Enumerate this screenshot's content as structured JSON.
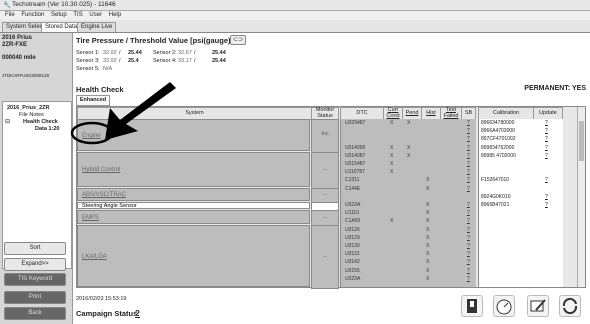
{
  "window": {
    "title": "Techstream (Ver 10.30.025) - 11646"
  },
  "menu": [
    "File",
    "Function",
    "Setup",
    "TIS",
    "User",
    "Help"
  ],
  "tabs": [
    "System Select",
    "Stored Data",
    "Engine Live"
  ],
  "vehicle": {
    "model": "2016 Prius",
    "engine": "2ZR-FXE",
    "mileage": "000040 mile",
    "vin": "JTDKARFU5G3008128"
  },
  "tree": {
    "root": "2016_Prius_2ZR",
    "file_notes": "File Notes",
    "health": "Health Check",
    "data": "Data 1:20"
  },
  "sidebar_buttons": [
    "Sort",
    "Expand>>",
    "TIS Keyword",
    "Print",
    "Back"
  ],
  "tire": {
    "title": "Tire Pressure / Threshold Value [psi(gauge)]",
    "sensor1_label": "Sensor 1:",
    "sensor1_value": "32.92",
    "sensor1_thr": "25.44",
    "sensor2_label": "Sensor 2:",
    "sensor2_value": "32.67",
    "sensor2_thr": "25.44",
    "sensor3_label": "Sensor 3:",
    "sensor3_value": "33.92",
    "sensor3_thr": "25.4",
    "sensor4_label": "Sensor 4:",
    "sensor4_value": "33.17",
    "sensor4_thr": "25.44",
    "sensor5_label": "Sensor 5:",
    "sensor5_value": "N/A"
  },
  "health": {
    "title": "Health Check",
    "tab": "Enhanced",
    "permanent": "PERMANENT: YES"
  },
  "grid_headers": {
    "system": "System",
    "monitor": "Monitor Status",
    "dtc": "DTC",
    "curr": "Curr Cond",
    "pend": "Pend",
    "hist": "Hist",
    "test": "Test Failed",
    "sb": "SB",
    "calibration": "Calibration",
    "update": "Update"
  },
  "systems": [
    {
      "name": "Engine",
      "monitor": "Inc"
    },
    {
      "name": "Hybrid Control",
      "monitor": "--"
    },
    {
      "name": "ABS/VSC/TRAC",
      "monitor": "--"
    },
    {
      "name": "Steering Angle Sensor",
      "monitor": ""
    },
    {
      "name": "EMPS",
      "monitor": "--"
    },
    {
      "name": "LKA/LDA",
      "monitor": "--"
    }
  ],
  "dtcs": [
    {
      "code": "U029487",
      "curr": "X",
      "pend": "X",
      "hist": "",
      "sb": "?"
    },
    {
      "code": "",
      "curr": "",
      "pend": "",
      "hist": "",
      "sb": "?"
    },
    {
      "code": "",
      "curr": "",
      "pend": "",
      "hist": "",
      "sb": "?"
    },
    {
      "code": "U014000",
      "curr": "X",
      "pend": "X",
      "hist": "",
      "sb": "?"
    },
    {
      "code": "U014087",
      "curr": "X",
      "pend": "X",
      "hist": "",
      "sb": "?"
    },
    {
      "code": "U015487",
      "curr": "X",
      "pend": "",
      "hist": "",
      "sb": "?"
    },
    {
      "code": "U110787",
      "curr": "X",
      "pend": "",
      "hist": "",
      "sb": "?"
    },
    {
      "code": "C1311",
      "curr": "",
      "pend": "",
      "hist": "X",
      "sb": "?"
    },
    {
      "code": "C144E",
      "curr": "",
      "pend": "",
      "hist": "X",
      "sb": "?"
    },
    {
      "code": "",
      "curr": "",
      "pend": "",
      "hist": "",
      "sb": ""
    },
    {
      "code": "U023A",
      "curr": "",
      "pend": "",
      "hist": "X",
      "sb": "?"
    },
    {
      "code": "U1110",
      "curr": "",
      "pend": "",
      "hist": "X",
      "sb": "?"
    },
    {
      "code": "C1A50",
      "curr": "X",
      "pend": "",
      "hist": "X",
      "sb": "?"
    },
    {
      "code": "U0126",
      "curr": "",
      "pend": "",
      "hist": "X",
      "sb": "?"
    },
    {
      "code": "U0129",
      "curr": "",
      "pend": "",
      "hist": "X",
      "sb": "?"
    },
    {
      "code": "U0130",
      "curr": "",
      "pend": "",
      "hist": "X",
      "sb": "?"
    },
    {
      "code": "U0131",
      "curr": "",
      "pend": "",
      "hist": "X",
      "sb": "?"
    },
    {
      "code": "U0142",
      "curr": "",
      "pend": "",
      "hist": "X",
      "sb": "?"
    },
    {
      "code": "U0155",
      "curr": "",
      "pend": "",
      "hist": "X",
      "sb": "?"
    },
    {
      "code": "U023A",
      "curr": "",
      "pend": "",
      "hist": "X",
      "sb": "?"
    }
  ],
  "calibrations": [
    {
      "id": "896634780000",
      "update": "?"
    },
    {
      "id": "8966A4703000",
      "update": "?"
    },
    {
      "id": "897CF4701002",
      "update": "?"
    },
    {
      "id": "899834762000",
      "update": "?"
    },
    {
      "id": "89985 4702000",
      "update": "?"
    },
    {
      "id": "",
      "update": ""
    },
    {
      "id": "",
      "update": ""
    },
    {
      "id": "F152647010",
      "update": "?"
    },
    {
      "id": "",
      "update": ""
    },
    {
      "id": "8924G0K010",
      "update": "?"
    },
    {
      "id": "8966B47021",
      "update": "?"
    }
  ],
  "footer": {
    "timestamp": "2016/02/03 15:53:19",
    "campaign_label": "Campaign Status:",
    "campaign_value": "?"
  },
  "colors": {
    "accent": "#000000",
    "grid_gray": "#bdbdbd",
    "highlight": "#ffffff"
  }
}
